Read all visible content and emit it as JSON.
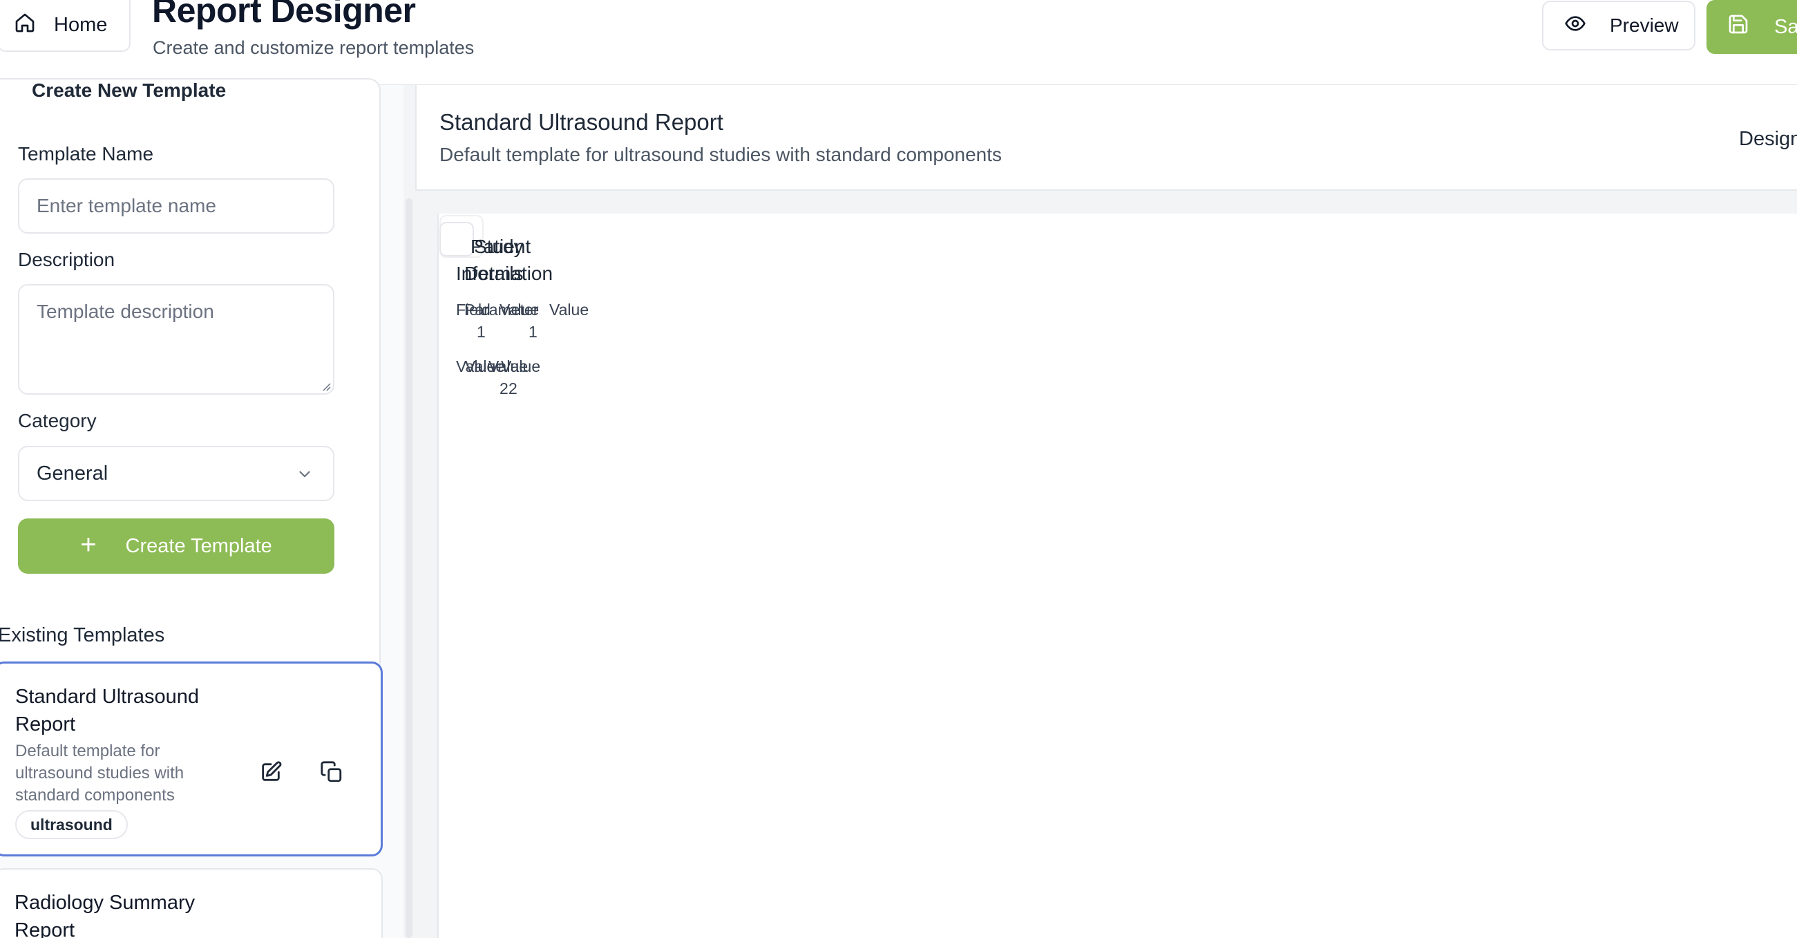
{
  "header": {
    "home_label": "Home",
    "title": "Report Designer",
    "subtitle": "Create and customize report templates",
    "preview_label": "Preview",
    "save_label": "Sa"
  },
  "create_form": {
    "heading": "Create New Template",
    "name_label": "Template Name",
    "name_placeholder": "Enter template name",
    "description_label": "Description",
    "description_placeholder": "Template description",
    "category_label": "Category",
    "category_value": "General",
    "create_button": "Create Template"
  },
  "existing": {
    "heading": "Existing Templates",
    "templates": [
      {
        "name": "Standard Ultrasound Report",
        "description": "Default template for ultrasound studies with standard components",
        "tag": "ultrasound"
      },
      {
        "name": "Radiology Summary Report"
      }
    ]
  },
  "canvas": {
    "title": "Standard Ultrasound Report",
    "description": "Default template for ultrasound studies with standard components",
    "mode_label": "Design",
    "components": [
      {
        "title": "Patient Information",
        "field_header": "Field",
        "value_header": "Value",
        "value_1": "1",
        "value_row": "Value",
        "value_2": "2"
      },
      {
        "title": "Study Details",
        "field_header": "Parameter",
        "value_header": "Value",
        "value_1": "1",
        "value_row": "Value",
        "value_2": "2"
      }
    ]
  },
  "colors": {
    "accent_green": "#8dbb55",
    "selected_border": "#5b7bd9",
    "border": "#e5e7eb"
  },
  "icons": [
    "home-icon",
    "eye-icon",
    "save-icon",
    "chevron-down-icon",
    "plus-icon",
    "edit-icon",
    "copy-icon"
  ]
}
